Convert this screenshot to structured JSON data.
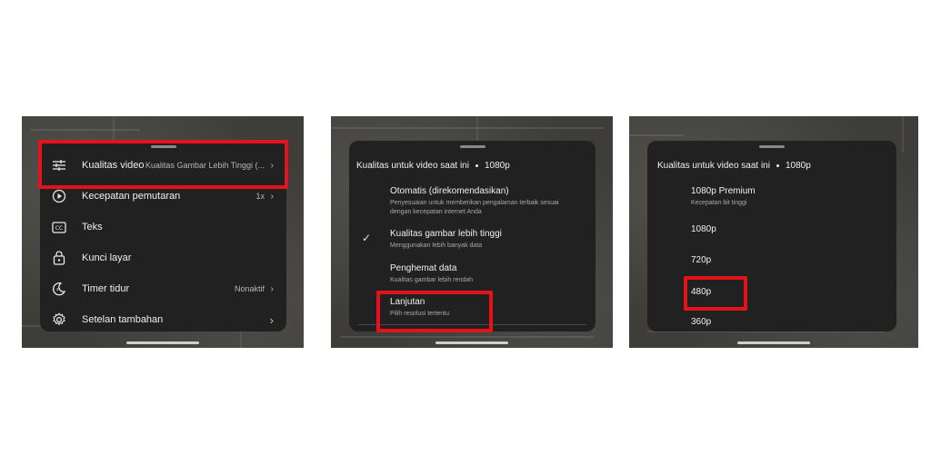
{
  "panel1": {
    "items": [
      {
        "label": "Kualitas video",
        "value": "Kualitas Gambar Lebih Tinggi (...",
        "icon": "sliders-icon"
      },
      {
        "label": "Kecepatan pemutaran",
        "value": "1x",
        "icon": "playback-speed-icon"
      },
      {
        "label": "Teks",
        "value": "",
        "icon": "captions-icon"
      },
      {
        "label": "Kunci layar",
        "value": "",
        "icon": "lock-icon"
      },
      {
        "label": "Timer tidur",
        "value": "Nonaktif",
        "icon": "sleep-timer-icon"
      },
      {
        "label": "Setelan tambahan",
        "value": "",
        "icon": "gear-icon"
      }
    ]
  },
  "panel2": {
    "header_title": "Kualitas untuk video saat ini",
    "header_value": "1080p",
    "options": [
      {
        "title": "Otomatis (direkomendasikan)",
        "subtitle": "Penyesuaian untuk memberikan pengalaman terbaik sesuai dengan kecepatan internet Anda"
      },
      {
        "title": "Kualitas gambar lebih tinggi",
        "subtitle": "Menggunakan lebih banyak data",
        "selected": true
      },
      {
        "title": "Penghemat data",
        "subtitle": "Kualitas gambar lebih rendah"
      },
      {
        "title": "Lanjutan",
        "subtitle": "Pilih resolusi tertentu"
      }
    ]
  },
  "panel3": {
    "header_title": "Kualitas untuk video saat ini",
    "header_value": "1080p",
    "options": [
      {
        "title": "1080p Premium",
        "subtitle": "Kecepatan bit tinggi"
      },
      {
        "title": "1080p"
      },
      {
        "title": "720p"
      },
      {
        "title": "480p"
      },
      {
        "title": "360p"
      }
    ]
  },
  "colors": {
    "highlight": "#e4131b",
    "sheet": "#212121"
  }
}
